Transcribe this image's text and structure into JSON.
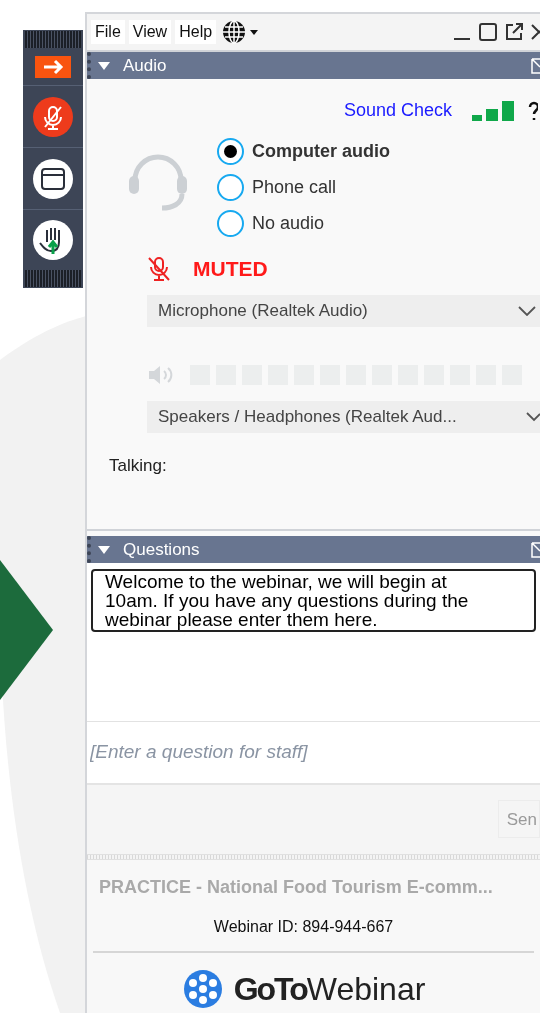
{
  "menu": [
    "File",
    "View",
    "Help"
  ],
  "audio": {
    "title": "Audio",
    "sound_check": "Sound Check",
    "options": [
      {
        "label": "Computer audio",
        "selected": true
      },
      {
        "label": "Phone call",
        "selected": false
      },
      {
        "label": "No audio",
        "selected": false
      }
    ],
    "status": "MUTED",
    "microphone": "Microphone (Realtek Audio)",
    "speaker_meter": {
      "level": 0
    },
    "speakers": "Speakers / Headphones (Realtek Aud...",
    "talking": "Talking:"
  },
  "questions": {
    "title": "Questions",
    "messages": [
      "Welcome to the webinar, we will begin at 10am. If you have any questions during the webinar please enter them here."
    ],
    "placeholder": "[Enter a question for staff]",
    "send": "Sen"
  },
  "footer": {
    "webinar_title": "PRACTICE - National Food Tourism E-comm...",
    "webinar_id": "Webinar ID: 894-944-667",
    "brand_bold": "GoTo",
    "brand_light": "Webinar"
  }
}
